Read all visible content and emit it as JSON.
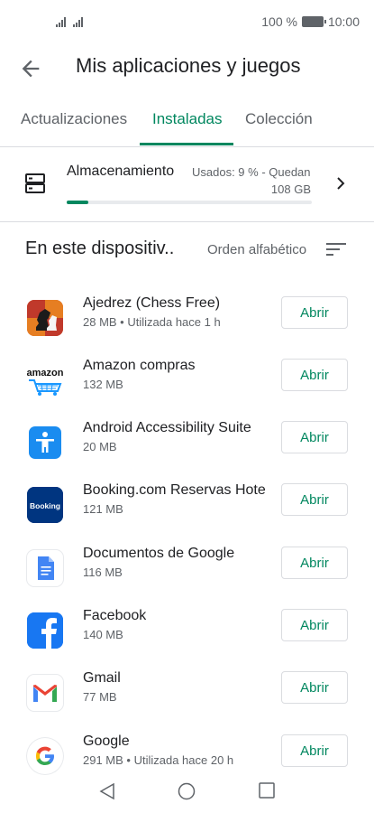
{
  "status_bar": {
    "battery": "100 %",
    "time": "10:00"
  },
  "header": {
    "title": "Mis aplicaciones y juegos"
  },
  "tabs": [
    {
      "label": "Actualizaciones",
      "active": false
    },
    {
      "label": "Instaladas",
      "active": true
    },
    {
      "label": "Colección",
      "active": false
    }
  ],
  "storage": {
    "title": "Almacenamiento",
    "used_text": "Usados: 9 % - Quedan",
    "free_text": "108 GB",
    "used_fraction": 0.09
  },
  "section": {
    "title": "En este dispositiv..",
    "sort_label": "Orden alfabético"
  },
  "apps": [
    {
      "name": "Ajedrez (Chess Free)",
      "meta": "28 MB • Utilizada hace 1 h",
      "button": "Abrir",
      "icon": "chess-icon"
    },
    {
      "name": "Amazon compras",
      "meta": "132 MB",
      "button": "Abrir",
      "icon": "amazon-icon"
    },
    {
      "name": "Android Accessibility Suite",
      "meta": "20 MB",
      "button": "Abrir",
      "icon": "accessibility-icon"
    },
    {
      "name": "Booking.com Reservas Hote",
      "meta": "121 MB",
      "button": "Abrir",
      "icon": "booking-icon"
    },
    {
      "name": "Documentos de Google",
      "meta": "116 MB",
      "button": "Abrir",
      "icon": "google-docs-icon"
    },
    {
      "name": "Facebook",
      "meta": "140 MB",
      "button": "Abrir",
      "icon": "facebook-icon"
    },
    {
      "name": "Gmail",
      "meta": "77 MB",
      "button": "Abrir",
      "icon": "gmail-icon"
    },
    {
      "name": "Google",
      "meta": "291 MB • Utilizada hace 20 h",
      "button": "Abrir",
      "icon": "google-icon"
    }
  ],
  "icon_texts": {
    "amazon": "amazon",
    "booking": "Booking"
  },
  "colors": {
    "accent": "#01875f"
  }
}
